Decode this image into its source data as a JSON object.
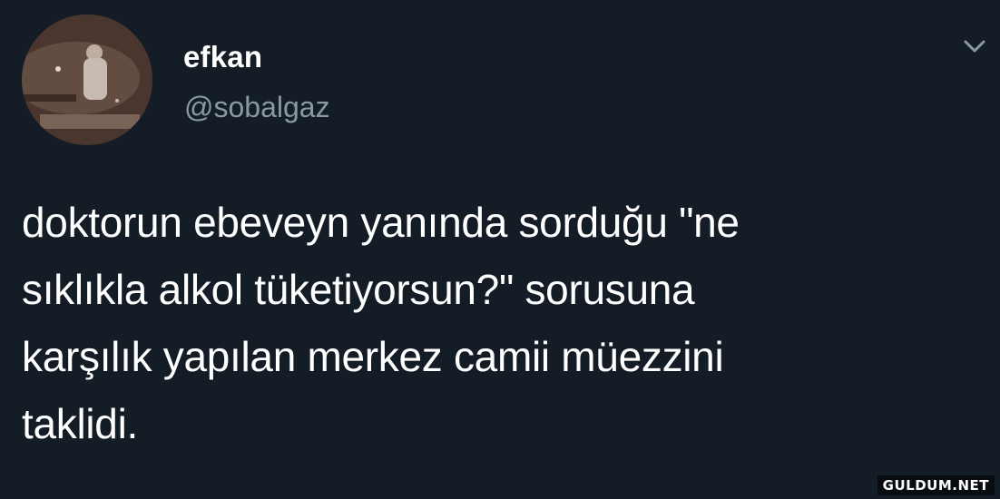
{
  "user": {
    "display_name": "efkan",
    "handle": "@sobalgaz"
  },
  "tweet": {
    "text": "doktorun ebeveyn yanında sorduğu \"ne\nsıklıkla alkol tüketiyorsun?\" sorusuna\nkarşılık yapılan merkez camii müezzini\ntaklidi."
  },
  "watermark": "GULDUM.NET",
  "colors": {
    "background": "#141d26",
    "text": "#ffffff",
    "secondary": "#8899a6"
  },
  "icons": {
    "menu": "chevron-down-icon"
  }
}
